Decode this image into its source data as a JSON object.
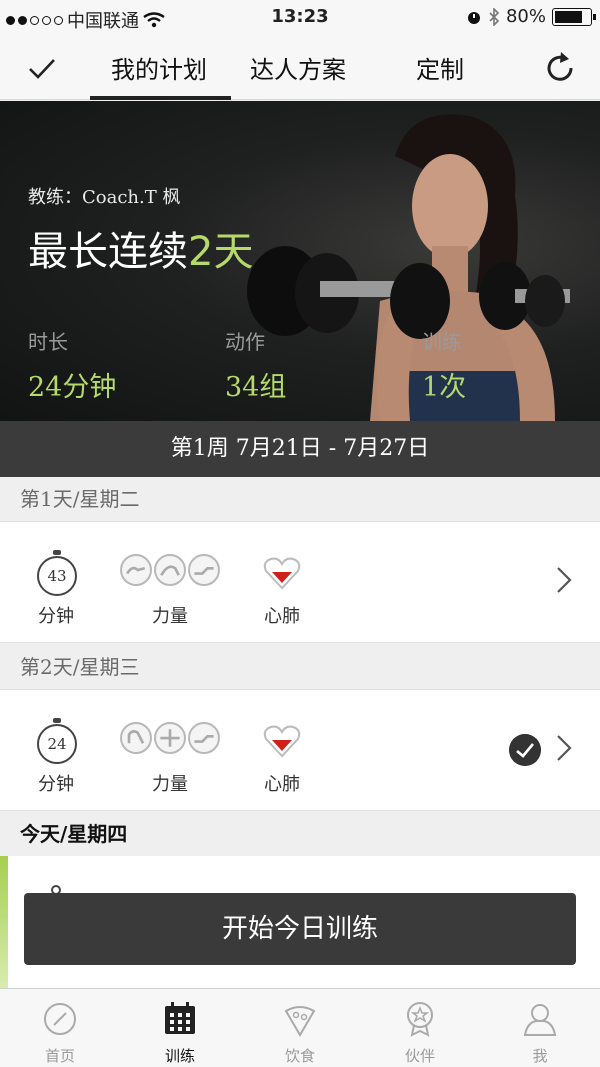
{
  "status_bar": {
    "carrier": "中国联通",
    "time": "13:23",
    "battery": "80%",
    "battery_level": 0.8
  },
  "top_nav": {
    "tabs": [
      {
        "label": "我的计划",
        "active": true
      },
      {
        "label": "达人方案",
        "active": false
      },
      {
        "label": "定制",
        "active": false
      }
    ]
  },
  "hero": {
    "coach": "教练：Coach.T 枫",
    "streak_prefix": "最长连续",
    "streak_value": "2天",
    "stats": [
      {
        "label": "时长",
        "value": "24分钟"
      },
      {
        "label": "动作",
        "value": "34组"
      },
      {
        "label": "训练",
        "value": "1次"
      }
    ]
  },
  "week": {
    "title": "第1周 7月21日 - 7月27日"
  },
  "days": [
    {
      "header": "第1天/星期二",
      "minutes": "43",
      "minutes_label": "分钟",
      "strength_label": "力量",
      "cardio_label": "心肺",
      "completed": false
    },
    {
      "header": "第2天/星期三",
      "minutes": "24",
      "minutes_label": "分钟",
      "strength_label": "力量",
      "cardio_label": "心肺",
      "completed": true
    }
  ],
  "today": {
    "header": "今天/星期四",
    "start_button": "开始今日训练"
  },
  "tab_bar": {
    "items": [
      {
        "label": "首页",
        "icon": "compass-icon"
      },
      {
        "label": "训练",
        "icon": "calendar-icon",
        "active": true
      },
      {
        "label": "饮食",
        "icon": "pizza-icon"
      },
      {
        "label": "伙伴",
        "icon": "badge-icon"
      },
      {
        "label": "我",
        "icon": "person-icon"
      }
    ]
  },
  "colors": {
    "accent_green": "#b6d96b",
    "dark_bar": "#3b3b3b",
    "heart_red": "#d0201b"
  }
}
